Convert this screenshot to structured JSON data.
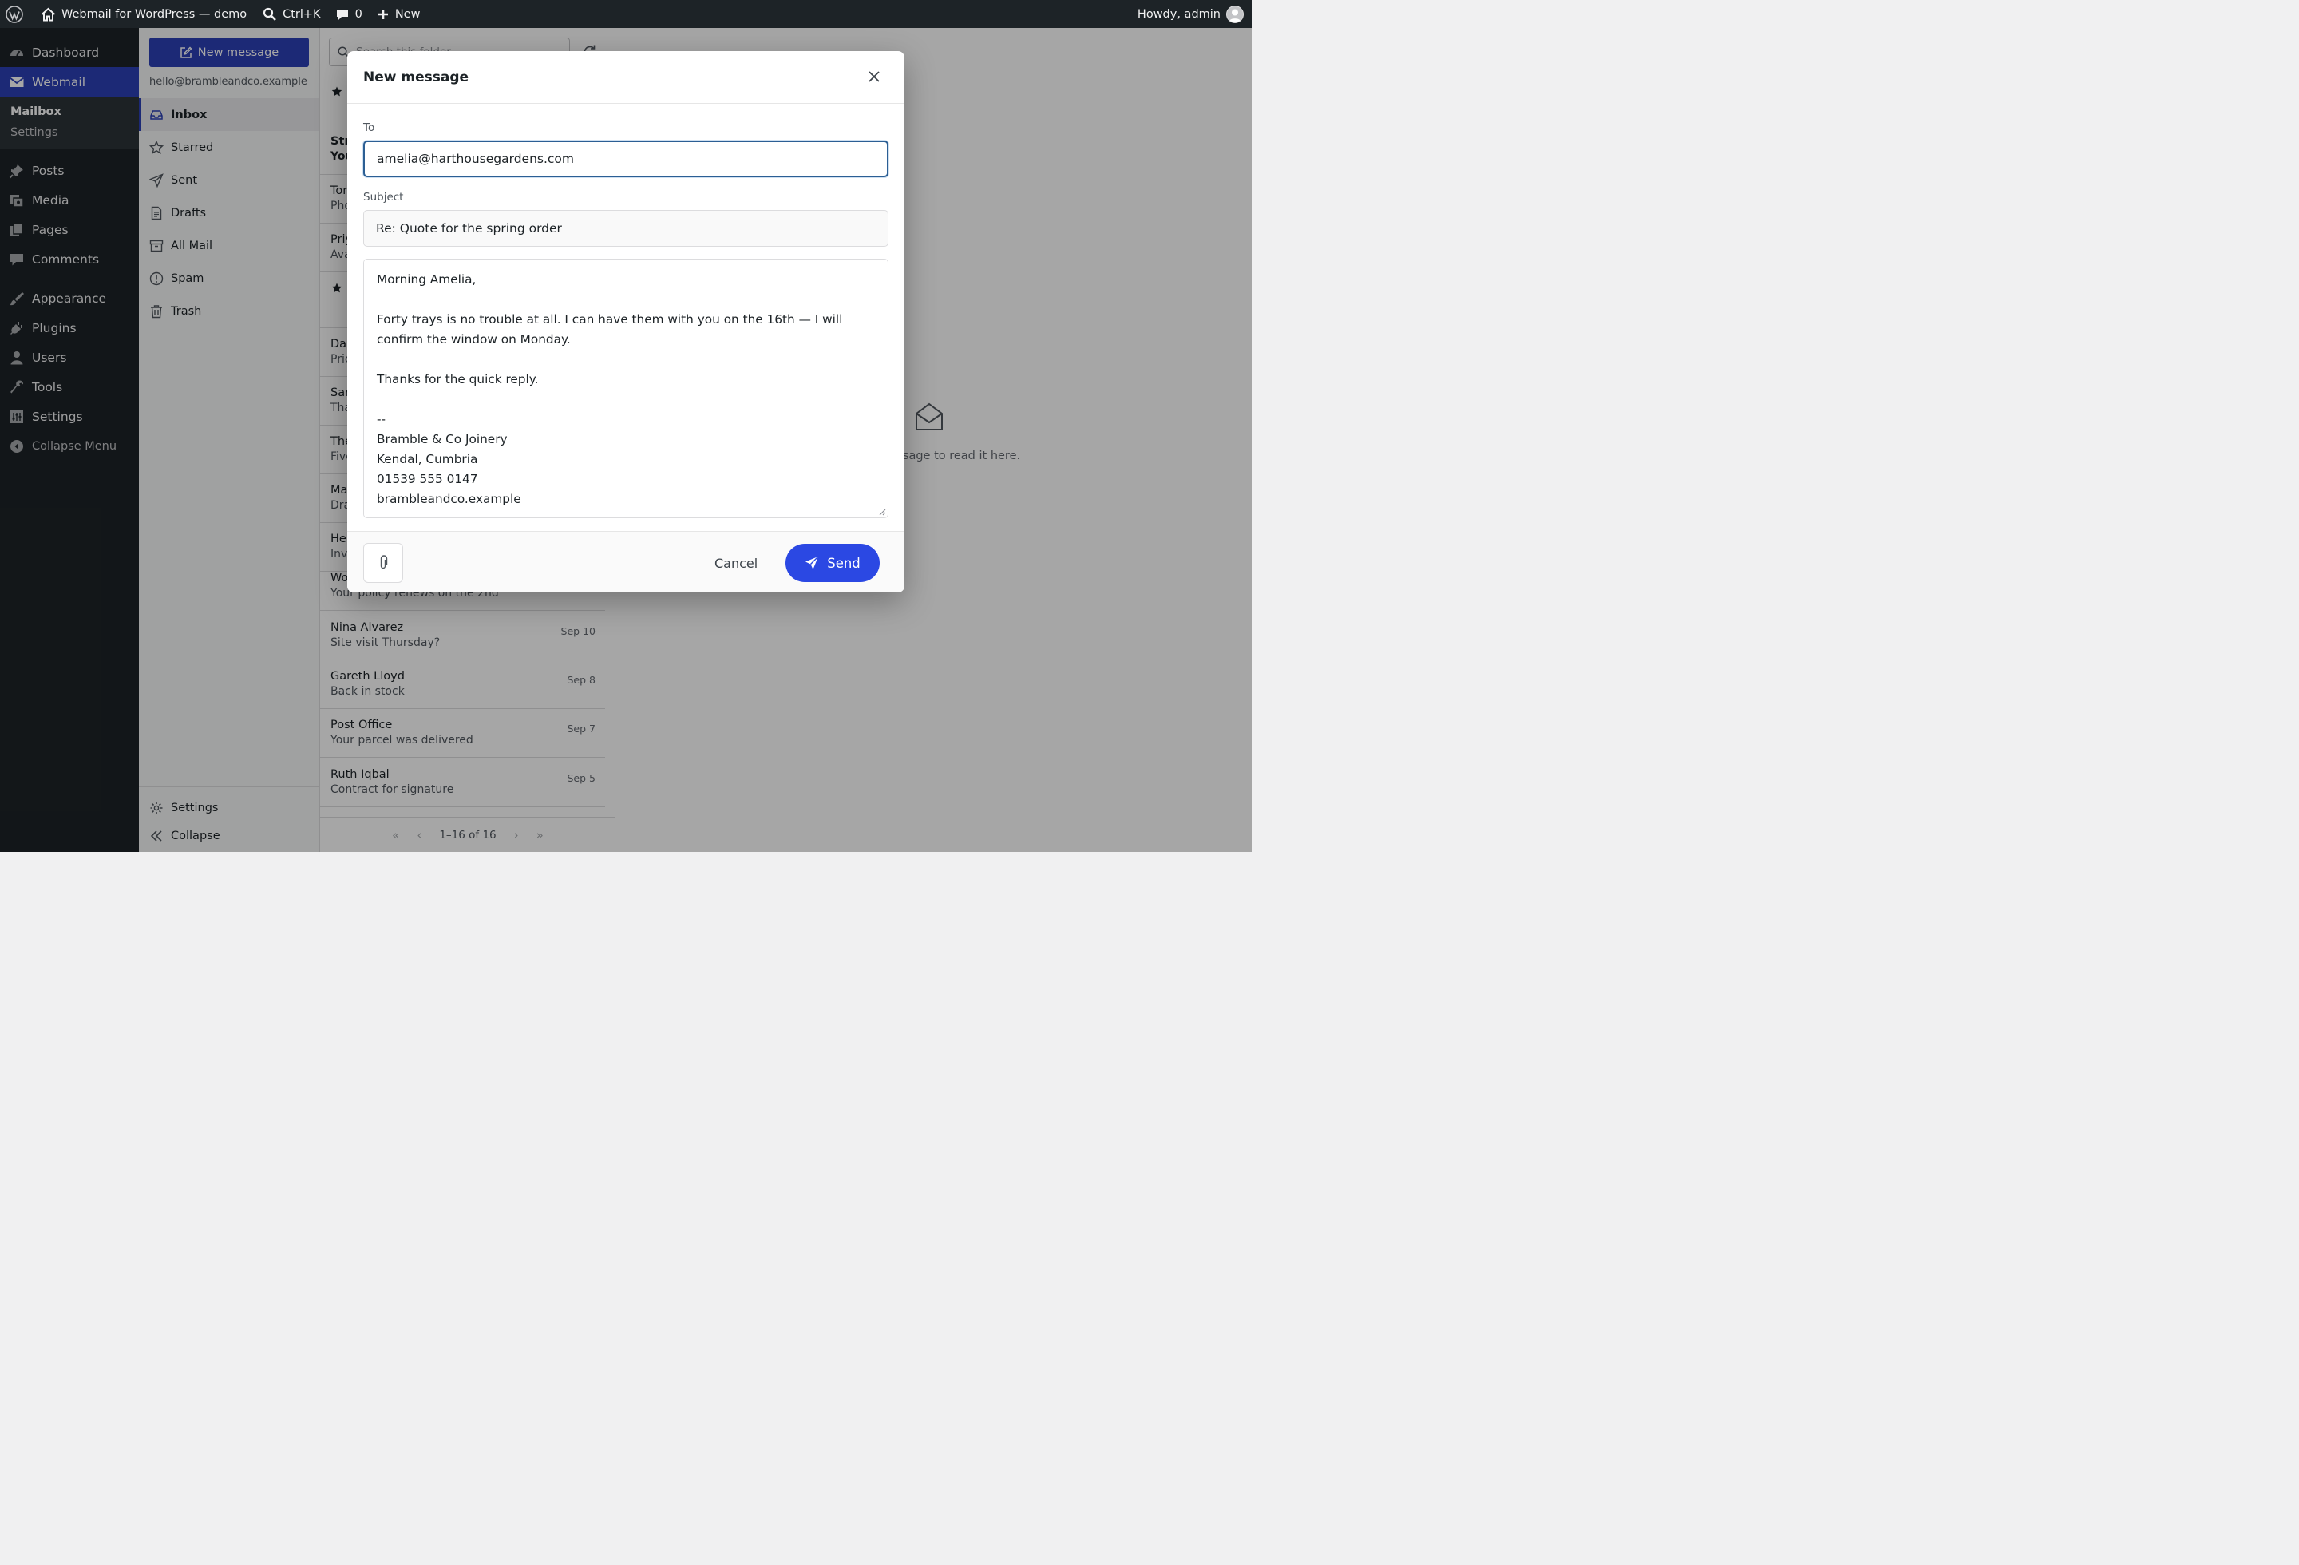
{
  "adminbar": {
    "site_name": "Webmail for WordPress — demo",
    "search_shortcut": "Ctrl+K",
    "comments_count": "0",
    "new_label": "New",
    "greeting": "Howdy, admin"
  },
  "adminmenu": {
    "items_top": [
      {
        "label": "Dashboard",
        "icon": "dashboard-icon"
      },
      {
        "label": "Webmail",
        "icon": "mail-icon"
      }
    ],
    "submenu": [
      "Mailbox",
      "Settings"
    ],
    "items_bottom": [
      {
        "label": "Posts",
        "icon": "pin-icon"
      },
      {
        "label": "Media",
        "icon": "media-icon"
      },
      {
        "label": "Pages",
        "icon": "pages-icon"
      },
      {
        "label": "Comments",
        "icon": "comment-icon"
      },
      {
        "label": "Appearance",
        "icon": "brush-icon"
      },
      {
        "label": "Plugins",
        "icon": "plugin-icon"
      },
      {
        "label": "Users",
        "icon": "users-icon"
      },
      {
        "label": "Tools",
        "icon": "wrench-icon"
      },
      {
        "label": "Settings",
        "icon": "sliders-icon"
      }
    ],
    "collapse_label": "Collapse Menu"
  },
  "folders": {
    "new_message_label": "New message",
    "account": "hello@brambleandco.example",
    "list": [
      "Inbox",
      "Starred",
      "Sent",
      "Drafts",
      "All Mail",
      "Spam",
      "Trash"
    ],
    "settings_label": "Settings",
    "collapse_label": "Collapse"
  },
  "messages": {
    "search_placeholder": "Search this folder",
    "rows": [
      {
        "from": "",
        "subject": "",
        "date": ""
      },
      {
        "from": "Str",
        "subject": "You",
        "date": ""
      },
      {
        "from": "Ton",
        "subject": "Pho",
        "date": ""
      },
      {
        "from": "Priy",
        "subject": "Ava",
        "date": ""
      },
      {
        "from": "",
        "subject": "",
        "date": ""
      },
      {
        "from": "Dan",
        "subject": "Pric",
        "date": ""
      },
      {
        "from": "Sar",
        "subject": "Tha",
        "date": ""
      },
      {
        "from": "The",
        "subject": "Five",
        "date": ""
      },
      {
        "from": "Ma",
        "subject": "Dra",
        "date": ""
      },
      {
        "from": "Hel",
        "subject": "Inv",
        "date": ""
      },
      {
        "from": "Wo",
        "subject": "Your policy renews on the 2nd",
        "date": ""
      },
      {
        "from": "Nina Alvarez",
        "subject": "Site visit Thursday?",
        "date": "Sep 10"
      },
      {
        "from": "Gareth Lloyd",
        "subject": "Back in stock",
        "date": "Sep 8"
      },
      {
        "from": "Post Office",
        "subject": "Your parcel was delivered",
        "date": "Sep 7"
      },
      {
        "from": "Ruth Iqbal",
        "subject": "Contract for signature",
        "date": "Sep 5"
      }
    ],
    "pagination": "1–16 of 16"
  },
  "reader": {
    "empty_text": "sage to read it here."
  },
  "compose": {
    "title": "New message",
    "to_label": "To",
    "to_value": "amelia@harthousegardens.com",
    "subject_label": "Subject",
    "subject_value": "Re: Quote for the spring order",
    "body": "Morning Amelia,\n\nForty trays is no trouble at all. I can have them with you on the 16th — I will confirm the window on Monday.\n\nThanks for the quick reply.\n\n--\nBramble & Co Joinery\nKendal, Cumbria\n01539 555 0147\nbrambleandco.example",
    "cancel_label": "Cancel",
    "send_label": "Send"
  },
  "colors": {
    "accent": "#2b3fb6",
    "send": "#2b48e3",
    "adminbar": "#1d2327"
  }
}
